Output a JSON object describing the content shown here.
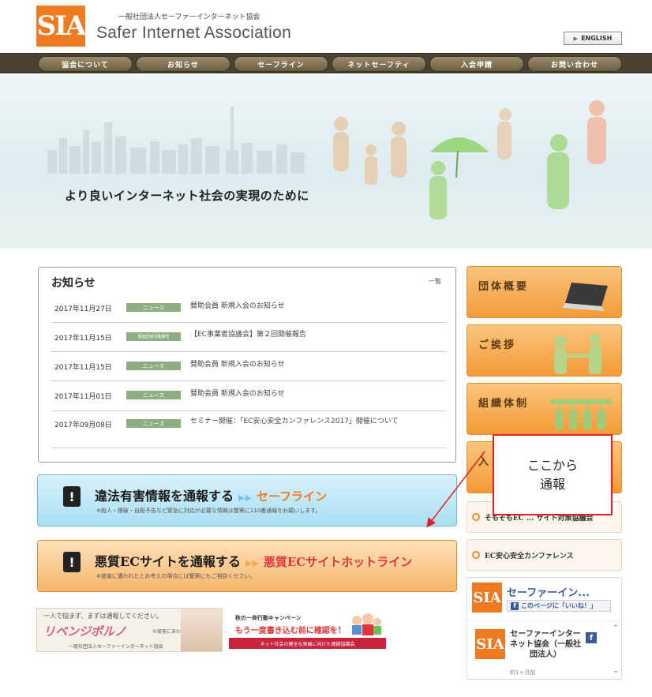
{
  "header": {
    "logo_text": "SIA",
    "org_name_jp": "一般社団法人セーファーインターネット協会",
    "org_name_en": "Safer Internet Association",
    "english_button": "ENGLISH"
  },
  "nav": [
    "協会について",
    "お知らせ",
    "セーフライン",
    "ネットセーフティ",
    "入会申請",
    "お問い合わせ"
  ],
  "hero": {
    "tagline": "より良いインターネット社会の実現のために"
  },
  "news": {
    "title": "お知らせ",
    "more_label": "一覧",
    "items": [
      {
        "date": "2017年11月27日",
        "badge": "ニュース",
        "text": "賛助会員 新規入会のお知らせ"
      },
      {
        "date": "2017年11月15日",
        "badge": "関連団体活動報告",
        "text": "【EC事業者協議会】第２回開催報告"
      },
      {
        "date": "2017年11月15日",
        "badge": "ニュース",
        "text": "賛助会員 新規入会のお知らせ"
      },
      {
        "date": "2017年11月01日",
        "badge": "ニュース",
        "text": "賛助会員 新規入会のお知らせ"
      },
      {
        "date": "2017年09月08日",
        "badge": "ニュース",
        "text": "セミナー開催：「EC安心安全カンファレンス2017」開催について"
      }
    ]
  },
  "banners": {
    "safeline": {
      "main": "違法有害情報を通報する",
      "accent": "セーフライン",
      "sub": "※殺人・爆破・自殺予告など緊急に対応が必要な情報は警察に110番通報をお願いします。"
    },
    "ec": {
      "main": "悪質ECサイトを通報する",
      "accent": "悪質ECサイトホットライン",
      "sub": "※被害に遭われたとお考えの場合には警察にもご相談ください。"
    }
  },
  "ads": {
    "revenge": {
      "line1": "一人で悩まず、まずは通報してください。",
      "headline": "リベンジポルノ",
      "headline_suffix": "の被害にあわれたら",
      "footer": "一般社団法人セーファーインターネット協会"
    },
    "campaign": {
      "line1": "秋の一斉行動キャンペーン",
      "headline": "もう一度書き込む前に確認を！",
      "bar": "ネット社会の健全な発展に向けた連絡協議会"
    }
  },
  "sidebar": {
    "cards": [
      "団体概要",
      "ご挨拶",
      "組織体制",
      "入"
    ],
    "links": [
      "そもそもEC ... サイト対策協議会",
      "EC安心安全カンファレンス"
    ]
  },
  "facebook": {
    "page_name": "セーファーイン...",
    "like_label": "このページに「いいね！」",
    "feed_name": "セーファーインターネット協会（一般社団法人）",
    "feed_time": "約1ヶ月前"
  },
  "annotation": {
    "lines": [
      "ここから",
      "通報"
    ],
    "color": "#e41e25"
  }
}
